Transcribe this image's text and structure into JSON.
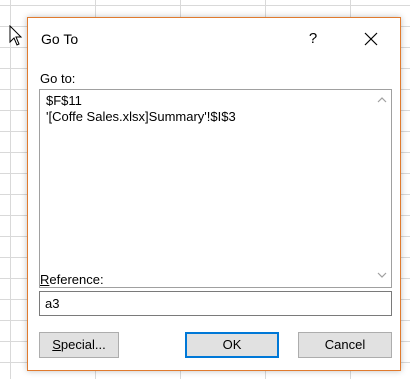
{
  "dialog": {
    "title": "Go To",
    "help_label": "?",
    "goto_label": "Go to:",
    "goto_items": [
      "$F$11",
      "'[Coffe Sales.xlsx]Summary'!$I$3"
    ],
    "reference_label_accel": "R",
    "reference_label_rest": "eference:",
    "reference_value": "a3",
    "buttons": {
      "special_accel": "S",
      "special_rest": "pecial...",
      "ok": "OK",
      "cancel": "Cancel"
    }
  },
  "colors": {
    "dialog_border": "#e07a2e",
    "default_button_border": "#0078d7",
    "button_face": "#e1e1e1",
    "grid_line": "#d9d9d9"
  },
  "icons": [
    "pointer-cursor-icon",
    "close-icon",
    "scroll-up-arrow-icon",
    "scroll-down-arrow-icon"
  ]
}
